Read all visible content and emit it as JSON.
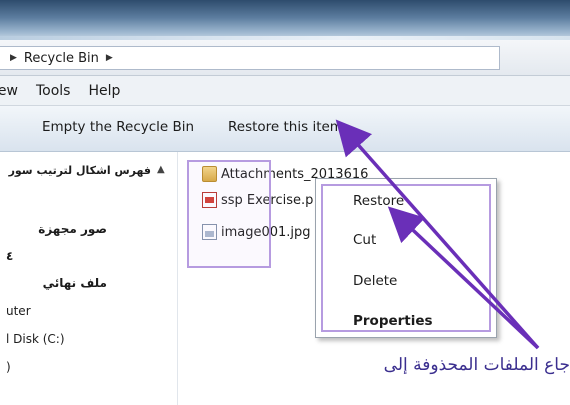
{
  "address_bar": {
    "location": "Recycle Bin"
  },
  "menu": {
    "items": [
      "iew",
      "Tools",
      "Help"
    ]
  },
  "toolbar": {
    "empty_label": "Empty the Recycle Bin",
    "restore_label": "Restore this item"
  },
  "nav": {
    "items": [
      {
        "label": "فهرس اشكال لترتيب سور",
        "bold": true
      },
      {
        "label": "صور مجهزة",
        "bold": true
      },
      {
        "label": "٤",
        "bold": true
      },
      {
        "label": "ملف نهائي",
        "bold": true
      },
      {
        "label": "uter",
        "bold": false
      },
      {
        "label": "l Disk (C:)",
        "bold": false
      },
      {
        "label": ")",
        "bold": false
      }
    ]
  },
  "files": [
    {
      "name": "Attachments_2013616",
      "icon": "folder-icon"
    },
    {
      "name": "ssp Exercise.p",
      "icon": "pdf-file-icon"
    },
    {
      "name": "image001.jpg",
      "icon": "image-file-icon"
    }
  ],
  "context_menu": {
    "items": [
      {
        "label": "Restore",
        "bold": false
      },
      {
        "label": "Cut",
        "bold": false
      },
      {
        "label": "Delete",
        "bold": false
      },
      {
        "label": "Properties",
        "bold": true
      }
    ]
  },
  "caption": "جاع الملفات المحذوفة إلى",
  "colors": {
    "highlight_border": "#b69be0",
    "arrow": "#6a2fb8",
    "caption_text": "#3b2f8f"
  }
}
